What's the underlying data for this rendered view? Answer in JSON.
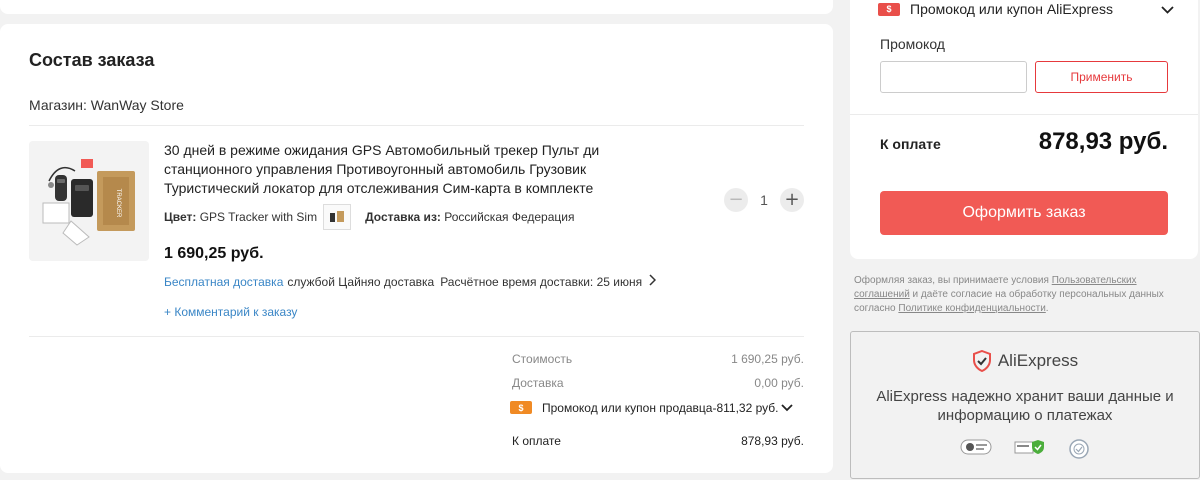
{
  "order": {
    "title": "Состав заказа",
    "store_prefix": "Магазин:",
    "store_name": "WanWay Store",
    "item": {
      "title": "30 дней в режиме ожидания GPS Автомобильный трекер Пульт ди станционного управления Противоугонный автомобиль Грузовик Туристический локатор для отслеживания Сим-карта в комплекте",
      "color_label": "Цвет:",
      "color_value": "GPS Tracker with Sim",
      "ship_from_label": "Доставка из:",
      "ship_from_value": "Российская Федерация",
      "quantity": "1",
      "price": "1 690,25 руб.",
      "free_shipping": "Бесплатная доставка",
      "carrier": "службой Цайняо доставка",
      "estimate": "Расчётное время доставки: 25 июня",
      "comment_link": "+ Комментарий к заказу",
      "thumb_label": "TRACKER"
    },
    "summary": {
      "cost_label": "Стоимость",
      "cost_value": "1 690,25 руб.",
      "delivery_label": "Доставка",
      "delivery_value": "0,00 руб.",
      "promo_label": "Промокод или купон продавца",
      "promo_value": "-811,32 руб.",
      "total_label": "К оплате",
      "total_value": "878,93 руб."
    }
  },
  "sidebar": {
    "promo_header": "Промокод или купон AliExpress",
    "promo_label": "Промокод",
    "promo_input_value": "",
    "apply_button": "Применить",
    "pay_label": "К оплате",
    "pay_value": "878,93 руб.",
    "order_button": "Оформить заказ",
    "terms_1": "Оформляя заказ, вы принимаете условия ",
    "terms_link_1": "Пользовательских соглашений",
    "terms_2": " и даёте согласие на обработку персональных данных согласно ",
    "terms_link_2": "Политике конфиденциальности",
    "terms_3": "."
  },
  "trust": {
    "brand": "AliExpress",
    "text": "AliExpress надежно хранит ваши данные и информацию о платежах",
    "badges": [
      "pci-badge",
      "secure-shield-badge",
      "certificate-badge"
    ]
  },
  "colors": {
    "accent": "#f15a55",
    "link": "#3a86c6",
    "coupon": "#f08a24",
    "coupon_ae": "#e94f4a"
  }
}
